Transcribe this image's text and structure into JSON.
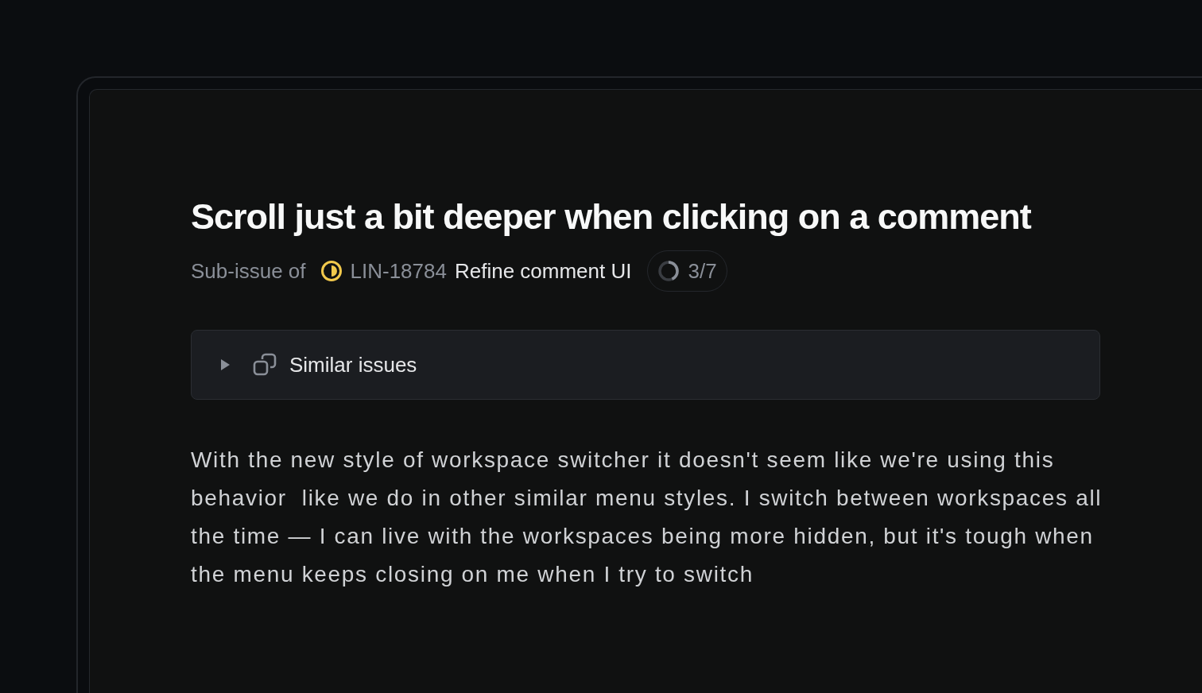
{
  "issue": {
    "title": "Scroll just a bit deeper when clicking on a comment",
    "parent": {
      "prefix": "Sub-issue of",
      "kind": "in_progress",
      "id": "LIN-18784",
      "title": "Refine comment UI",
      "progress": {
        "level": 0.43,
        "reading": "3/7"
      }
    },
    "similar_issues": {
      "label": "Similar issues",
      "expanded": false
    },
    "description": "With the new style of workspace switcher it doesn't seem like we're using this behavior  like we do in other similar menu styles. I switch between workspaces all the time — I can live with the workspaces being more hidden, but it's tough when the menu keeps closing on me when I try to switch"
  }
}
